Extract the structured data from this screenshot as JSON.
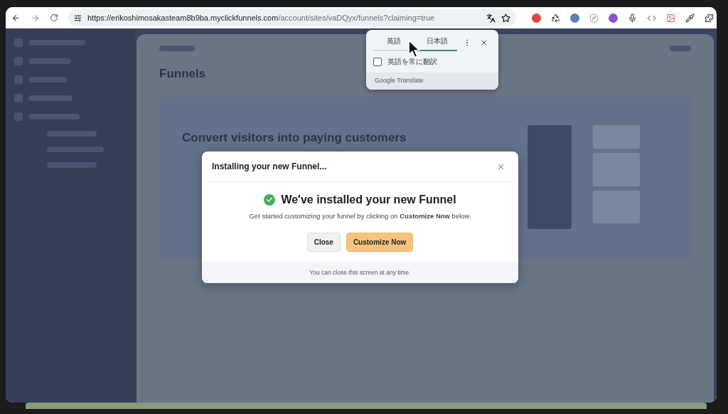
{
  "browser": {
    "url_host": "https://erikoshimosakasteam8b9ba.myclickfunnels.com",
    "url_path": "/account/sites/vaDQyx/funnels?claiming=true"
  },
  "translate_popup": {
    "tabs": [
      {
        "label": "英語",
        "selected": false
      },
      {
        "label": "日本語",
        "selected": true
      }
    ],
    "checkbox": {
      "label": "英語を常に翻訳",
      "checked": false
    },
    "footer": "Google Translate"
  },
  "page": {
    "title": "Funnels",
    "hero_title": "Convert visitors into paying customers"
  },
  "modal": {
    "title": "Installing your new Funnel...",
    "heading": "We've installed your new Funnel",
    "message": "Get started customizing your funnel by clicking on **Customize Now** below.",
    "buttons": [
      {
        "label": "Close",
        "kind": "secondary"
      },
      {
        "label": "Customize Now",
        "kind": "primary"
      }
    ],
    "footer": "You can close this screen at any time."
  }
}
